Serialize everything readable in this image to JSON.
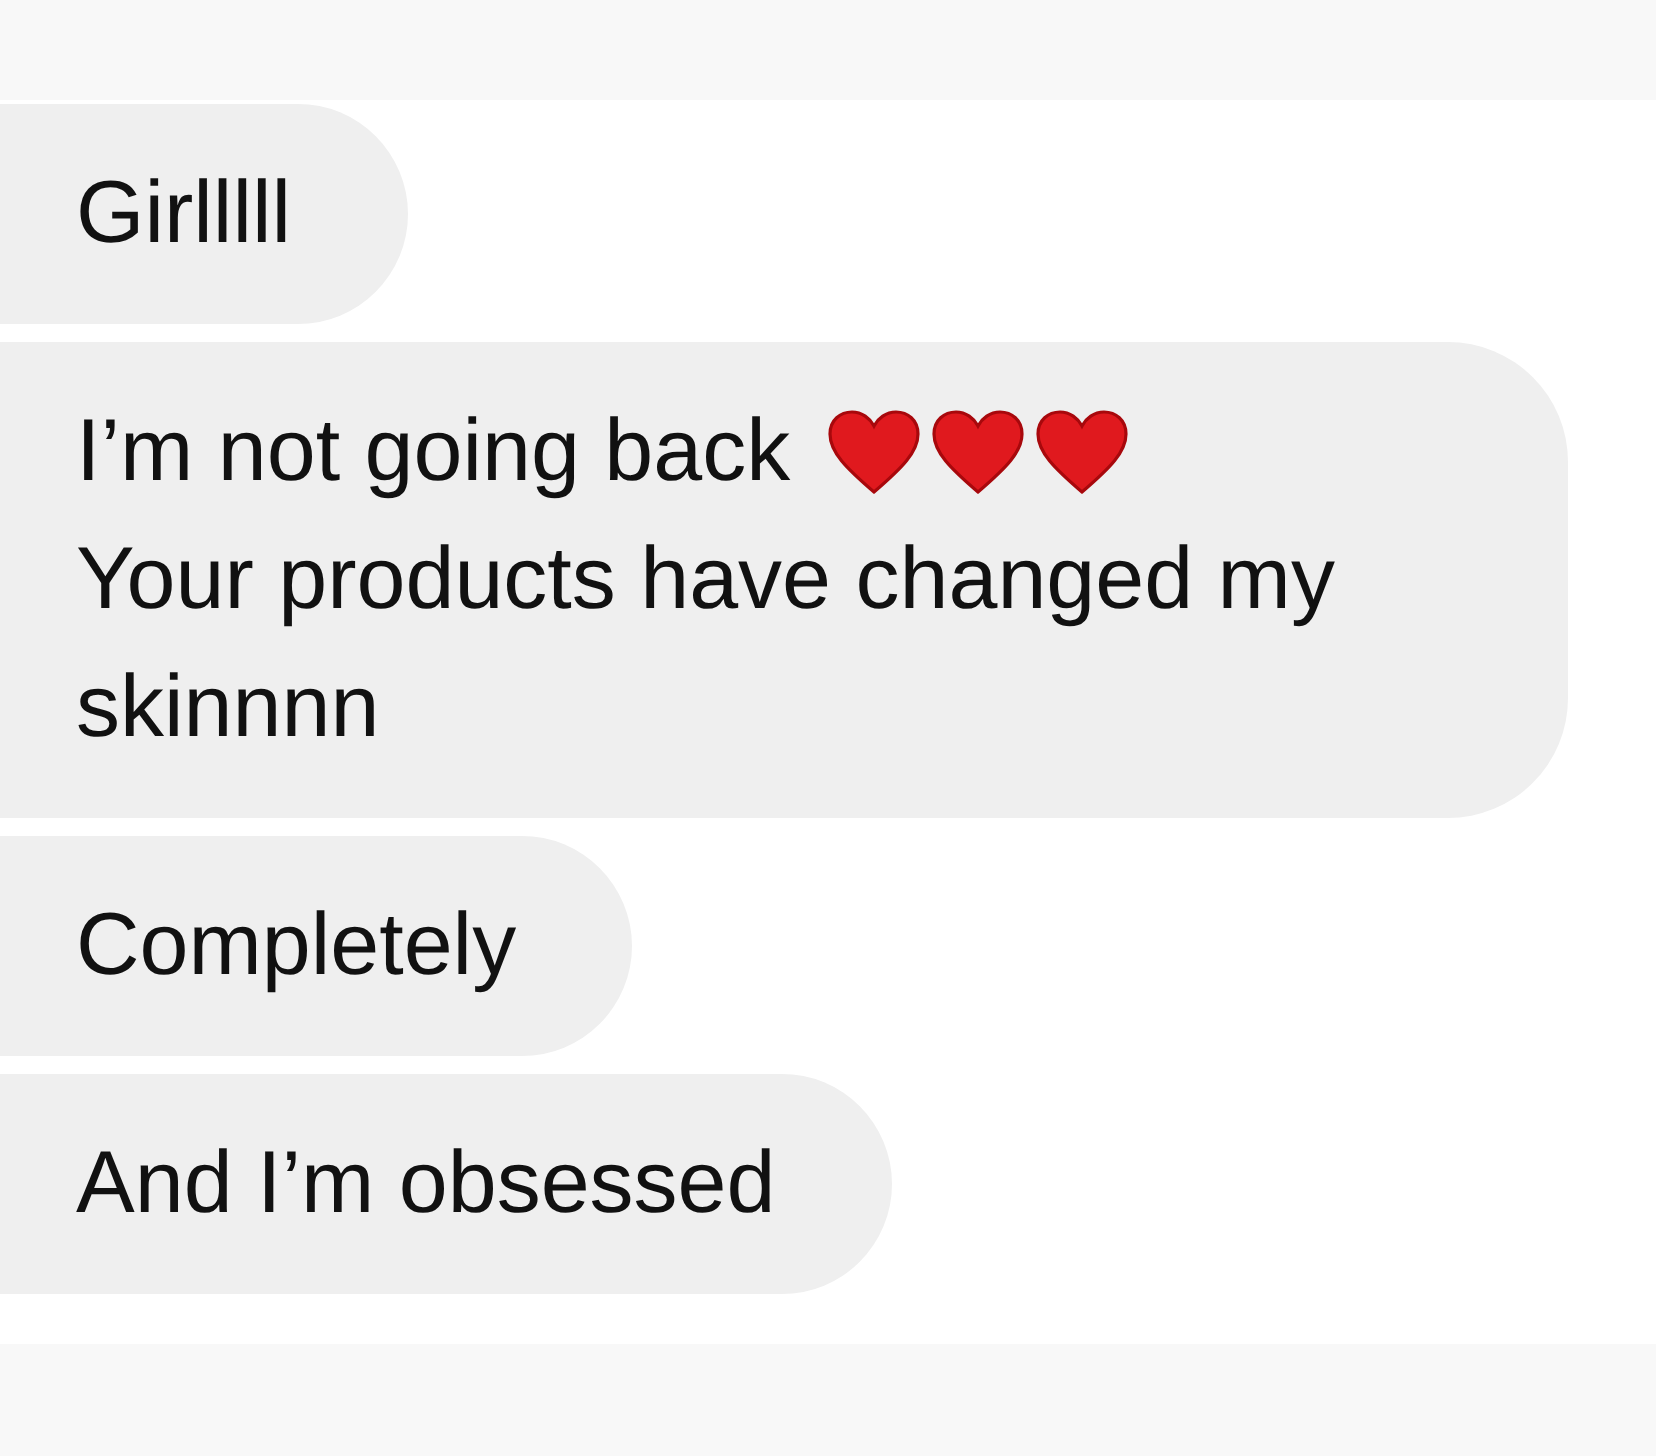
{
  "messages": [
    {
      "paragraphs": [
        {
          "text": "Girlllll"
        }
      ]
    },
    {
      "paragraphs": [
        {
          "text": "I’m not going back",
          "icons": [
            {
              "kind": "heart"
            },
            {
              "kind": "heart"
            },
            {
              "kind": "heart"
            }
          ]
        },
        {
          "text": "Your products have changed my skinnnn"
        }
      ]
    },
    {
      "paragraphs": [
        {
          "text": "Completely"
        }
      ]
    },
    {
      "paragraphs": [
        {
          "text": "And I’m obsessed"
        }
      ]
    }
  ]
}
